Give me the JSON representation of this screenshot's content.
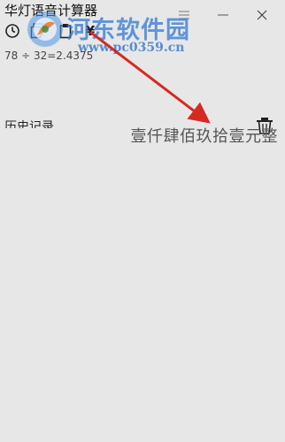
{
  "window": {
    "title": "华灯语音计算器"
  },
  "toolbar": {
    "currency_symbol": "¥"
  },
  "watermark": {
    "name": "河东软件园",
    "url": "www.pc0359.cn"
  },
  "display": {
    "expression": "78 ÷ 32=2.4375",
    "result": "壹仟肆佰玖拾壹元整"
  },
  "history": {
    "label": "历史记录"
  },
  "colors": {
    "background": "#e7e7e7",
    "arrow": "#d42a22",
    "watermark": "#3278d2"
  }
}
